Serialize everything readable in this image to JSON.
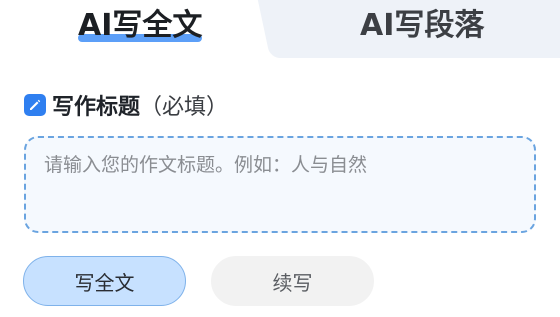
{
  "tabs": [
    {
      "label": "AI写全文",
      "active": true
    },
    {
      "label": "AI写段落",
      "active": false
    }
  ],
  "section": {
    "icon": "edit-icon",
    "title": "写作标题",
    "hint": "（必填）"
  },
  "title_input": {
    "value": "",
    "placeholder": "请输入您的作文标题。例如：人与自然"
  },
  "buttons": {
    "primary": "写全文",
    "secondary": "续写"
  },
  "colors": {
    "accent": "#2f7ff0",
    "tab_underline": "#3f8ef7",
    "primary_button_bg": "#c7e1ff",
    "input_border": "#6aa4e0"
  }
}
